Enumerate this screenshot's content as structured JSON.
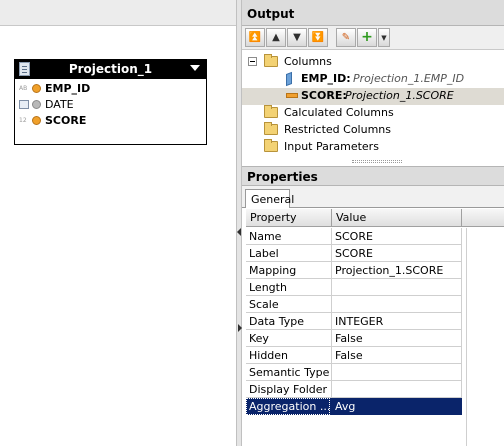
{
  "projection_node": {
    "title": "Projection_1",
    "rows": [
      {
        "type": "AB",
        "label": "EMP_ID",
        "bold": true,
        "bullet_color": "#f0a02a"
      },
      {
        "type": "",
        "label": "DATE",
        "bold": false,
        "bullet_color": "#b8b8b8"
      },
      {
        "type": "12",
        "label": "SCORE",
        "bold": true,
        "bullet_color": "#f0a02a"
      }
    ]
  },
  "output": {
    "title": "Output",
    "toolbar": [
      "move-top",
      "move-up",
      "move-down",
      "move-bottom",
      "edit",
      "add",
      "dropdown"
    ],
    "tree": {
      "columns_label": "Columns",
      "empid_label": "EMP_ID:",
      "empid_source": "Projection_1.EMP_ID",
      "score_label": "SCORE:",
      "score_source": "Projection_1.SCORE",
      "calculated_label": "Calculated Columns",
      "restricted_label": "Restricted Columns",
      "input_params_label": "Input Parameters"
    }
  },
  "properties": {
    "title": "Properties",
    "tab": "General",
    "headers": {
      "property": "Property",
      "value": "Value"
    },
    "rows": [
      {
        "property": "Name",
        "value": "SCORE"
      },
      {
        "property": "Label",
        "value": "SCORE"
      },
      {
        "property": "Mapping",
        "value": "Projection_1.SCORE"
      },
      {
        "property": "Length",
        "value": ""
      },
      {
        "property": "Scale",
        "value": ""
      },
      {
        "property": "Data Type",
        "value": "INTEGER"
      },
      {
        "property": "Key",
        "value": "False"
      },
      {
        "property": "Hidden",
        "value": "False"
      },
      {
        "property": "Semantic Type",
        "value": ""
      },
      {
        "property": "Display Folder",
        "value": ""
      },
      {
        "property": "Aggregation ...",
        "value": "Avg"
      }
    ],
    "selected_row_index": 10,
    "selection_color": "#0a246a"
  }
}
